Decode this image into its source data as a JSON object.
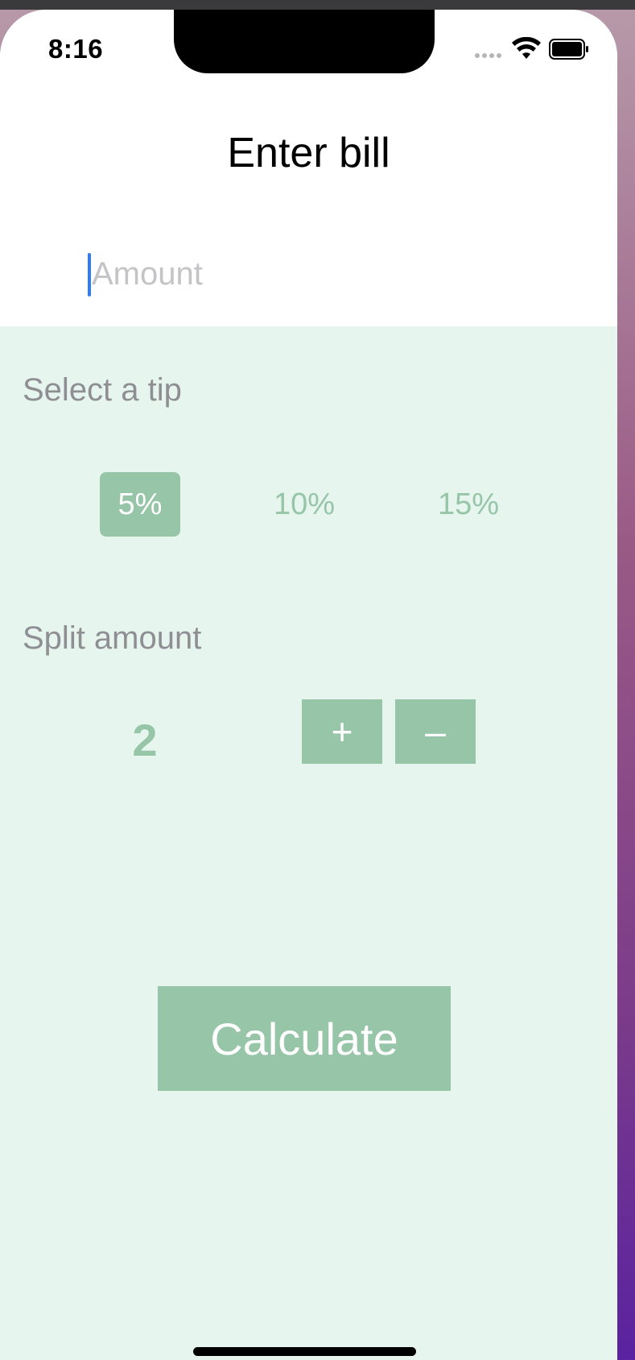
{
  "status_bar": {
    "time": "8:16",
    "icons": [
      "signal-dots-icon",
      "wifi-icon",
      "battery-icon"
    ]
  },
  "header": {
    "title": "Enter bill"
  },
  "amount_input": {
    "placeholder": "Amount",
    "value": ""
  },
  "tip_section": {
    "label": "Select a tip",
    "options": [
      "5%",
      "10%",
      "15%"
    ],
    "selected": "5%"
  },
  "split_section": {
    "label": "Split amount",
    "value": "2",
    "increment_label": "+",
    "decrement_label": "–"
  },
  "calculate_button": {
    "label": "Calculate"
  },
  "colors": {
    "accent": "#97c5a8",
    "background": "#e6f5ee",
    "label_gray": "#8e8e93",
    "caret": "#2f7cf6"
  }
}
